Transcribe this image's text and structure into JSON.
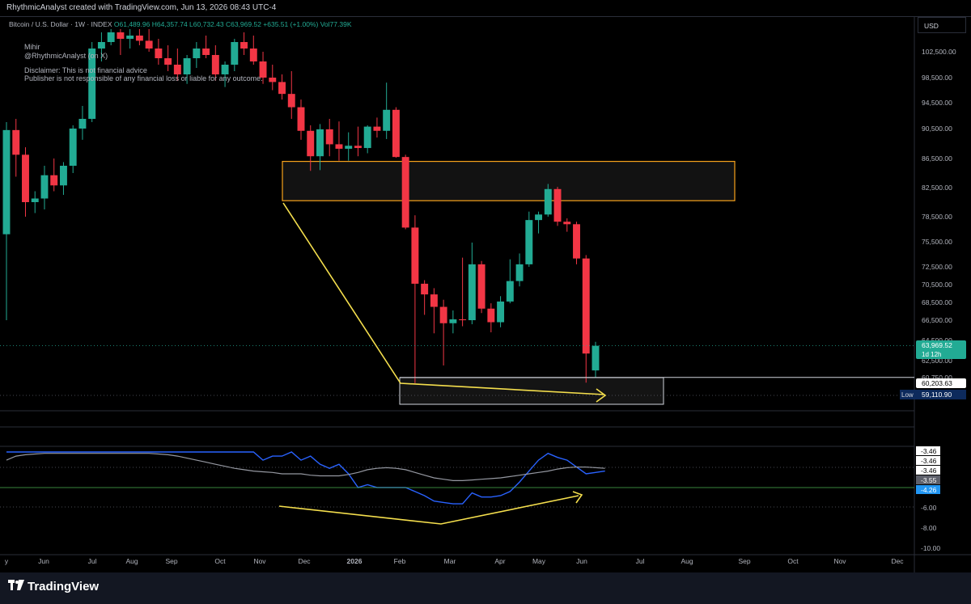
{
  "header": {
    "credit": "RhythmicAnalyst created with TradingView.com, Jun 13, 2026 08:43 UTC-4"
  },
  "legend": {
    "symbol": "Bitcoin / U.S. Dollar · 1W · INDEX",
    "open": "O61,489.96",
    "high": "H64,357.74",
    "low": "L60,732.43",
    "close": "C63,969.52",
    "change": "+635.51 (+1.00%)",
    "volume": "Vol77.39K"
  },
  "annotations": {
    "author_name": "Mihir",
    "author_handle": "@RhythmicAnalyst (on X)",
    "disclaimer_1": "Disclaimer: This is not financial advice",
    "disclaimer_2": "Publisher is not responsible of any financial loss or liable for any outcome."
  },
  "currency": "USD",
  "branding": "TradingView",
  "colors": {
    "up": "#22ab94",
    "down": "#f23645",
    "zone": "#f7a21b",
    "arrow": "#f5df4d",
    "indicator": "#2962ff",
    "indicator_ma": "#9598a1",
    "level": "#4caf50",
    "low_badge": "#0d2a5c"
  },
  "chart_data": [
    {
      "type": "candlestick",
      "title": "Bitcoin / U.S. Dollar · 1W · INDEX",
      "y_ticks": [
        102500,
        98500,
        94500,
        90500,
        86500,
        82500,
        78500,
        75500,
        72500,
        70500,
        68500,
        66500,
        64500,
        62500,
        60750
      ],
      "y_tick_labels": [
        "102,500.00",
        "98,500.00",
        "94,500.00",
        "90,500.00",
        "86,500.00",
        "82,500.00",
        "78,500.00",
        "75,500.00",
        "72,500.00",
        "70,500.00",
        "68,500.00",
        "66,500.00",
        "64,500.00",
        "62,500.00",
        "60,750.00"
      ],
      "x_labels": [
        "y",
        "Jun",
        "Jul",
        "Aug",
        "Sep",
        "Oct",
        "Nov",
        "Dec",
        "2026",
        "Feb",
        "Mar",
        "Apr",
        "May",
        "Jun",
        "Jul",
        "Aug",
        "Sep",
        "Oct",
        "Nov",
        "Dec"
      ],
      "candles": [
        {
          "o": 76400,
          "h": 91500,
          "l": 66500,
          "c": 90300
        },
        {
          "o": 90300,
          "h": 92000,
          "l": 84000,
          "c": 87000
        },
        {
          "o": 87000,
          "h": 88000,
          "l": 78500,
          "c": 80500
        },
        {
          "o": 80500,
          "h": 82000,
          "l": 79000,
          "c": 81000
        },
        {
          "o": 81000,
          "h": 85500,
          "l": 79500,
          "c": 84200
        },
        {
          "o": 84200,
          "h": 86500,
          "l": 82000,
          "c": 82800
        },
        {
          "o": 82800,
          "h": 86000,
          "l": 81500,
          "c": 85500
        },
        {
          "o": 85500,
          "h": 91000,
          "l": 84500,
          "c": 90500
        },
        {
          "o": 90500,
          "h": 94000,
          "l": 89000,
          "c": 92000
        },
        {
          "o": 92000,
          "h": 104000,
          "l": 91500,
          "c": 103000
        },
        {
          "o": 103000,
          "h": 105500,
          "l": 101000,
          "c": 104000
        },
        {
          "o": 104000,
          "h": 106000,
          "l": 103500,
          "c": 105500
        },
        {
          "o": 105500,
          "h": 106000,
          "l": 102000,
          "c": 104500
        },
        {
          "o": 104500,
          "h": 106000,
          "l": 103000,
          "c": 105000
        },
        {
          "o": 105000,
          "h": 106000,
          "l": 103500,
          "c": 104200
        },
        {
          "o": 104200,
          "h": 106000,
          "l": 102500,
          "c": 103000
        },
        {
          "o": 103000,
          "h": 104500,
          "l": 100500,
          "c": 101500
        },
        {
          "o": 101500,
          "h": 103500,
          "l": 99500,
          "c": 100500
        },
        {
          "o": 100500,
          "h": 103000,
          "l": 98000,
          "c": 99000
        },
        {
          "o": 99000,
          "h": 102000,
          "l": 97500,
          "c": 101500
        },
        {
          "o": 101500,
          "h": 104000,
          "l": 100000,
          "c": 103000
        },
        {
          "o": 103000,
          "h": 105000,
          "l": 101500,
          "c": 102000
        },
        {
          "o": 102000,
          "h": 103500,
          "l": 98000,
          "c": 99000
        },
        {
          "o": 99000,
          "h": 101000,
          "l": 97000,
          "c": 100500
        },
        {
          "o": 100500,
          "h": 104500,
          "l": 99500,
          "c": 104000
        },
        {
          "o": 104000,
          "h": 105500,
          "l": 102000,
          "c": 103000
        },
        {
          "o": 103000,
          "h": 105000,
          "l": 100500,
          "c": 101000
        },
        {
          "o": 101000,
          "h": 102500,
          "l": 97500,
          "c": 98500
        },
        {
          "o": 98500,
          "h": 100500,
          "l": 96500,
          "c": 97800
        },
        {
          "o": 97800,
          "h": 99000,
          "l": 95000,
          "c": 95900
        },
        {
          "o": 95900,
          "h": 99500,
          "l": 92000,
          "c": 93800
        },
        {
          "o": 93800,
          "h": 95000,
          "l": 89000,
          "c": 90200
        },
        {
          "o": 90200,
          "h": 91000,
          "l": 84800,
          "c": 86800
        },
        {
          "o": 86800,
          "h": 91200,
          "l": 84900,
          "c": 90400
        },
        {
          "o": 90400,
          "h": 92000,
          "l": 86800,
          "c": 88400
        },
        {
          "o": 88400,
          "h": 91600,
          "l": 86200,
          "c": 87800
        },
        {
          "o": 87800,
          "h": 90000,
          "l": 86200,
          "c": 88200
        },
        {
          "o": 88200,
          "h": 90800,
          "l": 86800,
          "c": 87900
        },
        {
          "o": 87900,
          "h": 91000,
          "l": 87200,
          "c": 90800
        },
        {
          "o": 90800,
          "h": 92200,
          "l": 89300,
          "c": 90200
        },
        {
          "o": 90200,
          "h": 97700,
          "l": 89100,
          "c": 93400
        },
        {
          "o": 93400,
          "h": 93800,
          "l": 86600,
          "c": 86700
        },
        {
          "o": 86700,
          "h": 87000,
          "l": 77000,
          "c": 77200
        },
        {
          "o": 77200,
          "h": 78700,
          "l": 60200,
          "c": 70600
        },
        {
          "o": 70600,
          "h": 71000,
          "l": 67100,
          "c": 69400
        },
        {
          "o": 69400,
          "h": 70100,
          "l": 65200,
          "c": 68000
        },
        {
          "o": 68000,
          "h": 68800,
          "l": 62000,
          "c": 66200
        },
        {
          "o": 66200,
          "h": 67600,
          "l": 65200,
          "c": 66600
        },
        {
          "o": 66600,
          "h": 73600,
          "l": 65900,
          "c": 66500
        },
        {
          "o": 66500,
          "h": 75400,
          "l": 66100,
          "c": 72800
        },
        {
          "o": 72800,
          "h": 73200,
          "l": 67300,
          "c": 67800
        },
        {
          "o": 67800,
          "h": 68400,
          "l": 65300,
          "c": 66300
        },
        {
          "o": 66300,
          "h": 69200,
          "l": 65800,
          "c": 68600
        },
        {
          "o": 68600,
          "h": 73400,
          "l": 68400,
          "c": 70900
        },
        {
          "o": 70900,
          "h": 74100,
          "l": 70300,
          "c": 72800
        },
        {
          "o": 72800,
          "h": 79200,
          "l": 72500,
          "c": 78100
        },
        {
          "o": 78100,
          "h": 79200,
          "l": 76500,
          "c": 78800
        },
        {
          "o": 78800,
          "h": 83000,
          "l": 78500,
          "c": 82300
        },
        {
          "o": 82300,
          "h": 82600,
          "l": 77400,
          "c": 77900
        },
        {
          "o": 77900,
          "h": 78300,
          "l": 76700,
          "c": 77600
        },
        {
          "o": 77600,
          "h": 77900,
          "l": 72800,
          "c": 73500
        },
        {
          "o": 73500,
          "h": 73900,
          "l": 60250,
          "c": 63200
        },
        {
          "o": 61490,
          "h": 64360,
          "l": 60730,
          "c": 63970
        }
      ],
      "zones": [
        {
          "name": "resistance-zone",
          "y1": 80700,
          "y2": 86100
        },
        {
          "name": "support-zone",
          "y1": 58100,
          "y2": 60750
        }
      ],
      "current_price": "63,969.52",
      "countdown": "1d 12h",
      "level_label": "60,203.63",
      "low_tag": "Low",
      "low_label": "59,110.90"
    },
    {
      "type": "line",
      "title": "",
      "y_tick_labels": [
        "-3.46",
        "-3.46",
        "-3.46",
        "-3.55",
        "-4.26",
        "-6.00",
        "-8.00",
        "-10.00"
      ],
      "series": [
        {
          "values": [
            -3.3,
            -3.3,
            -3.3,
            -3.3,
            -3.3,
            -3.3,
            -3.3,
            -3.3,
            -3.3,
            -3.3,
            -3.3,
            -3.3,
            -3.3,
            -3.3,
            -3.3,
            -3.3,
            -3.3,
            -3.3,
            -3.3,
            -3.3,
            -3.3,
            -3.3,
            -3.3,
            -3.3,
            -3.3,
            -3.3,
            -3.3,
            -3.9,
            -3.6,
            -3.6,
            -3.3,
            -3.9,
            -3.6,
            -4.2,
            -4.5,
            -4.2,
            -4.9,
            -5.9,
            -5.7,
            -5.9,
            -5.9,
            -5.9,
            -5.9,
            -6.2,
            -6.5,
            -6.9,
            -7.0,
            -7.1,
            -7.1,
            -6.3,
            -6.6,
            -6.6,
            -6.5,
            -6.2,
            -5.5,
            -4.7,
            -3.9,
            -3.4,
            -3.7,
            -3.9,
            -4.4,
            -4.9,
            -4.8,
            -4.7
          ]
        },
        {
          "values": [
            -3.9,
            -3.6,
            -3.5,
            -3.45,
            -3.4,
            -3.4,
            -3.4,
            -3.4,
            -3.4,
            -3.4,
            -3.4,
            -3.4,
            -3.4,
            -3.4,
            -3.4,
            -3.4,
            -3.45,
            -3.5,
            -3.6,
            -3.75,
            -3.9,
            -4.05,
            -4.2,
            -4.35,
            -4.5,
            -4.6,
            -4.7,
            -4.75,
            -4.8,
            -4.9,
            -4.9,
            -4.9,
            -5.0,
            -5.05,
            -5.05,
            -5.05,
            -4.95,
            -4.8,
            -4.6,
            -4.5,
            -4.45,
            -4.5,
            -4.6,
            -4.8,
            -5.0,
            -5.2,
            -5.3,
            -5.4,
            -5.4,
            -5.35,
            -5.3,
            -5.25,
            -5.2,
            -5.1,
            -5.0,
            -4.9,
            -4.8,
            -4.7,
            -4.55,
            -4.45,
            -4.4,
            -4.4,
            -4.45,
            -4.5
          ]
        }
      ]
    }
  ]
}
